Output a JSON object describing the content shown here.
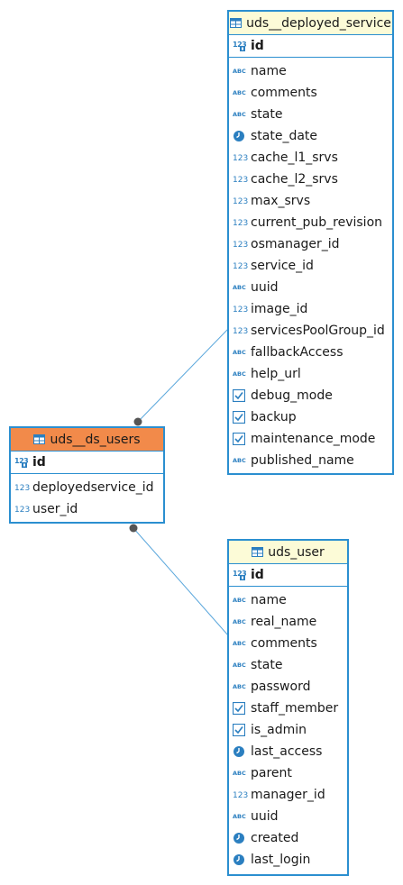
{
  "colors": {
    "border": "#2b8fd0",
    "header_bg": "#fcfbd7",
    "selected_header_bg": "#f28a4a",
    "icon": "#2b7fc0"
  },
  "tables": {
    "deployed_service": {
      "name": "uds__deployed_service",
      "pk": "id",
      "columns": [
        {
          "label": "name",
          "icon": "abc-icon"
        },
        {
          "label": "comments",
          "icon": "abc-icon"
        },
        {
          "label": "state",
          "icon": "abc-icon"
        },
        {
          "label": "state_date",
          "icon": "clock-icon"
        },
        {
          "label": "cache_l1_srvs",
          "icon": "number-icon"
        },
        {
          "label": "cache_l2_srvs",
          "icon": "number-icon"
        },
        {
          "label": "max_srvs",
          "icon": "number-icon"
        },
        {
          "label": "current_pub_revision",
          "icon": "number-icon"
        },
        {
          "label": "osmanager_id",
          "icon": "number-icon"
        },
        {
          "label": "service_id",
          "icon": "number-icon"
        },
        {
          "label": "uuid",
          "icon": "abc-icon"
        },
        {
          "label": "image_id",
          "icon": "number-icon"
        },
        {
          "label": "servicesPoolGroup_id",
          "icon": "number-icon"
        },
        {
          "label": "fallbackAccess",
          "icon": "abc-icon"
        },
        {
          "label": "help_url",
          "icon": "abc-icon"
        },
        {
          "label": "debug_mode",
          "icon": "checkbox-icon"
        },
        {
          "label": "backup",
          "icon": "checkbox-icon"
        },
        {
          "label": "maintenance_mode",
          "icon": "checkbox-icon"
        },
        {
          "label": "published_name",
          "icon": "abc-icon"
        }
      ]
    },
    "ds_users": {
      "name": "uds__ds_users",
      "pk": "id",
      "columns": [
        {
          "label": "deployedservice_id",
          "icon": "number-icon"
        },
        {
          "label": "user_id",
          "icon": "number-icon"
        }
      ]
    },
    "user": {
      "name": "uds_user",
      "pk": "id",
      "columns": [
        {
          "label": "name",
          "icon": "abc-icon"
        },
        {
          "label": "real_name",
          "icon": "abc-icon"
        },
        {
          "label": "comments",
          "icon": "abc-icon"
        },
        {
          "label": "state",
          "icon": "abc-icon"
        },
        {
          "label": "password",
          "icon": "abc-icon"
        },
        {
          "label": "staff_member",
          "icon": "checkbox-icon"
        },
        {
          "label": "is_admin",
          "icon": "checkbox-icon"
        },
        {
          "label": "last_access",
          "icon": "clock-icon"
        },
        {
          "label": "parent",
          "icon": "abc-icon"
        },
        {
          "label": "manager_id",
          "icon": "number-icon"
        },
        {
          "label": "uuid",
          "icon": "abc-icon"
        },
        {
          "label": "created",
          "icon": "clock-icon"
        },
        {
          "label": "last_login",
          "icon": "clock-icon"
        }
      ]
    }
  }
}
